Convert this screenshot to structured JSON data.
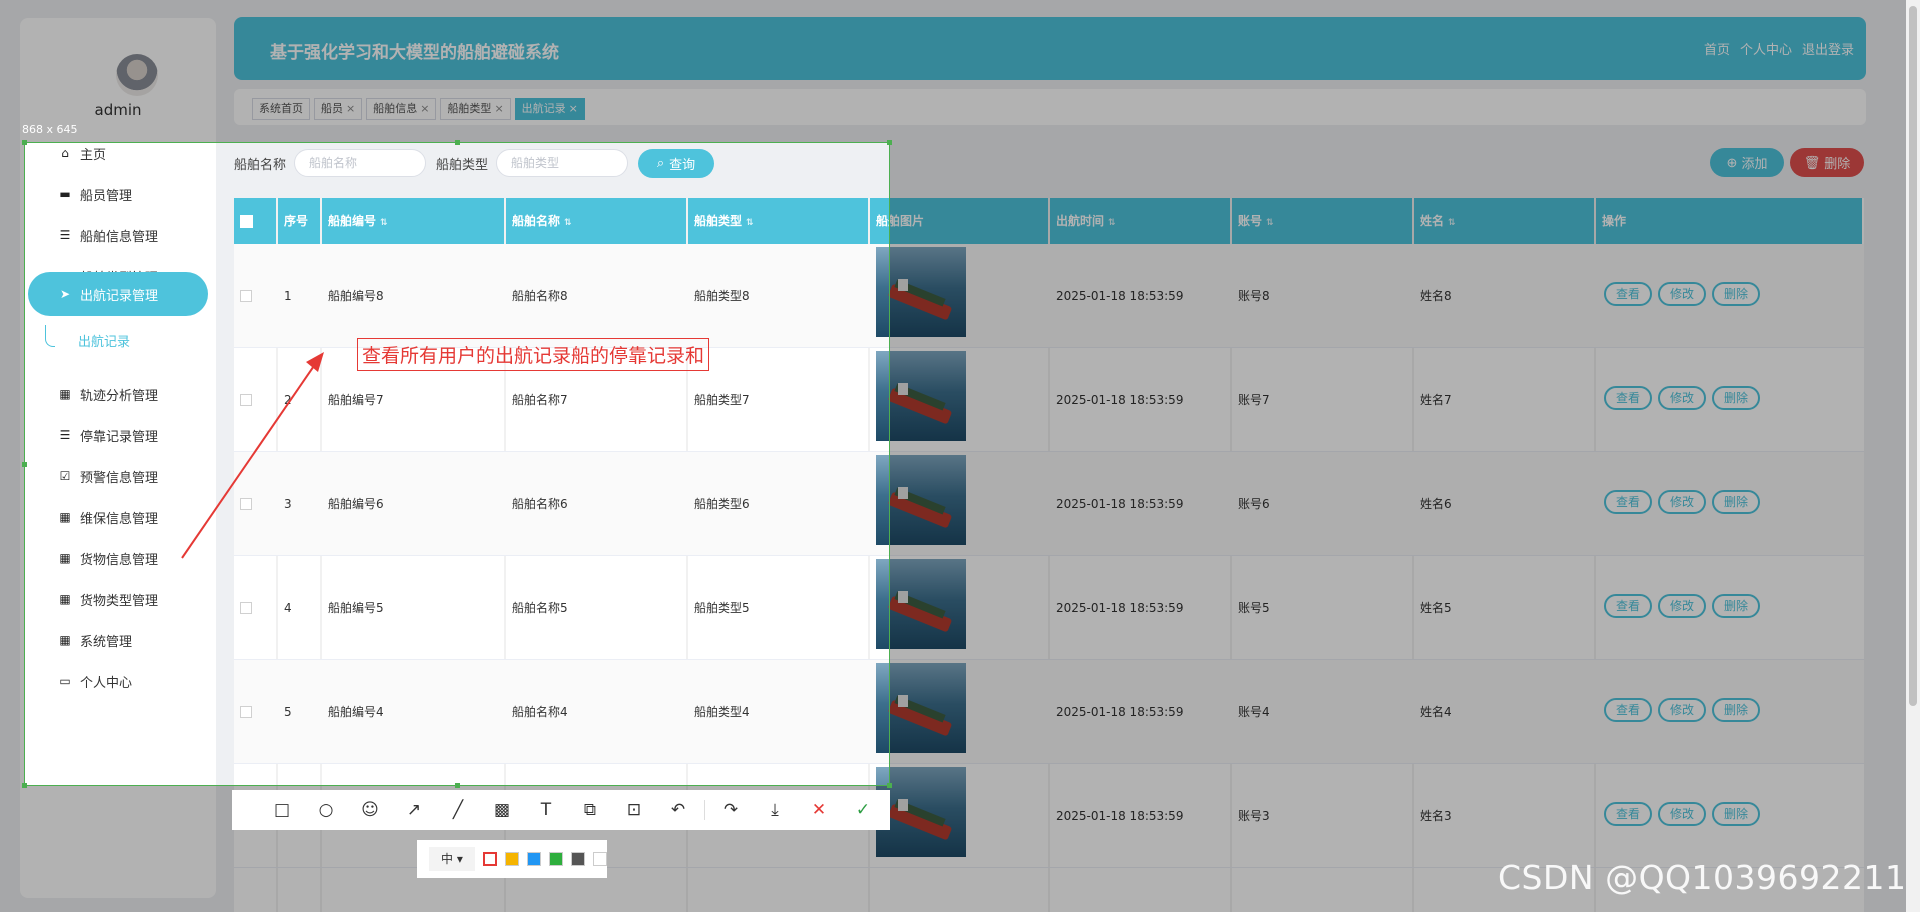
{
  "user": {
    "name": "admin"
  },
  "header": {
    "title": "基于强化学习和大模型的船舶避碰系统",
    "links": [
      "首页",
      "个人中心",
      "退出登录"
    ]
  },
  "tabs": [
    {
      "label": "系统首页",
      "closable": false
    },
    {
      "label": "船员",
      "closable": true
    },
    {
      "label": "船舶信息",
      "closable": true
    },
    {
      "label": "船舶类型",
      "closable": true
    },
    {
      "label": "出航记录",
      "closable": true,
      "active": true
    }
  ],
  "sidebar": {
    "items": [
      {
        "label": "主页",
        "icon": "home-icon",
        "glyph": "⌂"
      },
      {
        "label": "船员管理",
        "icon": "monitor-icon",
        "glyph": "▬"
      },
      {
        "label": "船舶信息管理",
        "icon": "sliders-icon",
        "glyph": "☰"
      },
      {
        "label": "船舶类型管理",
        "icon": "grid-icon",
        "glyph": "▦"
      },
      {
        "label": "出航记录管理",
        "icon": "paper-plane-icon",
        "glyph": "➤",
        "active": true
      },
      {
        "label": "轨迹分析管理",
        "icon": "grid-icon",
        "glyph": "▦"
      },
      {
        "label": "停靠记录管理",
        "icon": "list-icon",
        "glyph": "☰"
      },
      {
        "label": "预警信息管理",
        "icon": "clipboard-check-icon",
        "glyph": "☑"
      },
      {
        "label": "维保信息管理",
        "icon": "grid-icon",
        "glyph": "▦"
      },
      {
        "label": "货物信息管理",
        "icon": "grid-icon",
        "glyph": "▦"
      },
      {
        "label": "货物类型管理",
        "icon": "grid-icon",
        "glyph": "▦"
      },
      {
        "label": "系统管理",
        "icon": "apps-icon",
        "glyph": "▦"
      },
      {
        "label": "个人中心",
        "icon": "id-card-icon",
        "glyph": "▭"
      }
    ],
    "sub_item": "出航记录"
  },
  "search": {
    "ship_name_label": "船舶名称",
    "ship_name_placeholder": "船舶名称",
    "ship_type_label": "船舶类型",
    "ship_type_placeholder": "船舶类型",
    "query_label": "查询"
  },
  "actions": {
    "add_label": "添加",
    "delete_label": "删除"
  },
  "table": {
    "columns": [
      "序号",
      "船舶编号",
      "船舶名称",
      "船舶类型",
      "船舶图片",
      "出航时间",
      "账号",
      "姓名",
      "操作"
    ],
    "row_actions": [
      "查看",
      "修改",
      "删除"
    ],
    "rows": [
      {
        "idx": "1",
        "code": "船舶编号8",
        "name": "船舶名称8",
        "type": "船舶类型8",
        "time": "2025-01-18 18:53:59",
        "account": "账号8",
        "person": "姓名8"
      },
      {
        "idx": "2",
        "code": "船舶编号7",
        "name": "船舶名称7",
        "type": "船舶类型7",
        "time": "2025-01-18 18:53:59",
        "account": "账号7",
        "person": "姓名7"
      },
      {
        "idx": "3",
        "code": "船舶编号6",
        "name": "船舶名称6",
        "type": "船舶类型6",
        "time": "2025-01-18 18:53:59",
        "account": "账号6",
        "person": "姓名6"
      },
      {
        "idx": "4",
        "code": "船舶编号5",
        "name": "船舶名称5",
        "type": "船舶类型5",
        "time": "2025-01-18 18:53:59",
        "account": "账号5",
        "person": "姓名5"
      },
      {
        "idx": "5",
        "code": "船舶编号4",
        "name": "船舶名称4",
        "type": "船舶类型4",
        "time": "2025-01-18 18:53:59",
        "account": "账号4",
        "person": "姓名4"
      },
      {
        "idx": "",
        "code": "",
        "name": "",
        "type": "",
        "time": "2025-01-18 18:53:59",
        "account": "账号3",
        "person": "姓名3"
      }
    ]
  },
  "overlay": {
    "size_readout": "868 x 645",
    "annotation_text": "查看所有用户的出航记录船的停靠记录和",
    "font_size_option": "中 ▾",
    "tools": [
      "rectangle-icon",
      "circle-icon",
      "emoji-icon",
      "arrow-icon",
      "line-icon",
      "mosaic-icon",
      "text-icon",
      "copy-icon",
      "ocr-icon",
      "undo-icon",
      "redo-icon",
      "save-icon",
      "cancel-icon",
      "confirm-icon"
    ],
    "tool_glyphs": [
      "□",
      "○",
      "☺",
      "↗",
      "╱",
      "▩",
      "T",
      "⧉",
      "⊡",
      "↶",
      "↷",
      "⤓",
      "✕",
      "✓"
    ],
    "colors": [
      "#e53935",
      "#f5b400",
      "#2196f3",
      "#2eae3d",
      "#555555",
      "#ffffff"
    ]
  },
  "watermark": "CSDN @QQ1039692211"
}
